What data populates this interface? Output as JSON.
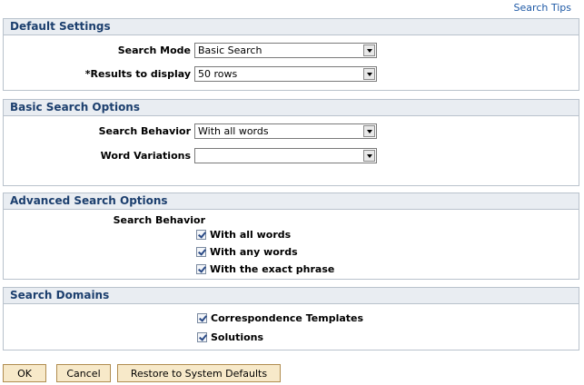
{
  "search_tips_link": "Search Tips",
  "default_settings": {
    "title": "Default Settings",
    "search_mode_label": "Search Mode",
    "search_mode_value": "Basic Search",
    "results_label": "*Results to display",
    "results_value": "50 rows"
  },
  "basic_search": {
    "title": "Basic Search Options",
    "behavior_label": "Search Behavior",
    "behavior_value": "With all words",
    "variations_label": "Word Variations",
    "variations_value": ""
  },
  "advanced_search": {
    "title": "Advanced Search Options",
    "behavior_label": "Search Behavior",
    "options": [
      {
        "label": "With all words",
        "checked": true
      },
      {
        "label": "With any words",
        "checked": true
      },
      {
        "label": "With the exact phrase",
        "checked": true
      }
    ]
  },
  "search_domains": {
    "title": "Search Domains",
    "options": [
      {
        "label": "Correspondence Templates",
        "checked": true
      },
      {
        "label": "Solutions",
        "checked": true
      }
    ]
  },
  "buttons": {
    "ok": "OK",
    "cancel": "Cancel",
    "restore": "Restore to System Defaults"
  }
}
